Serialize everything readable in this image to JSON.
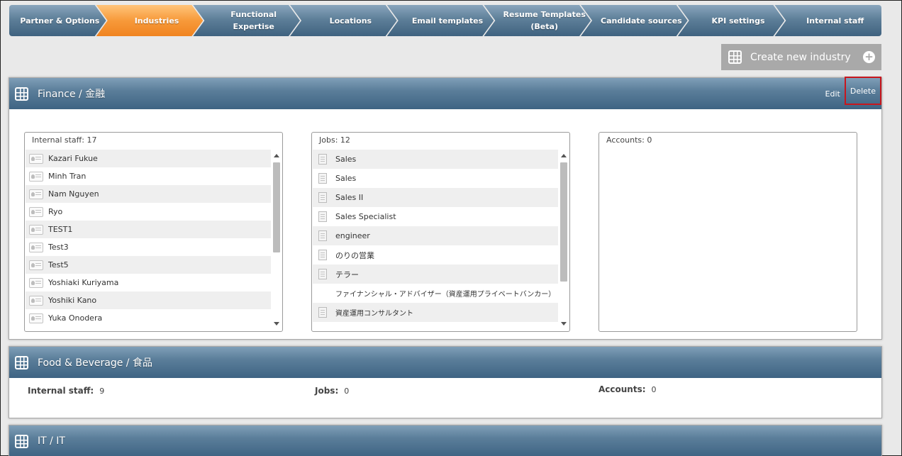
{
  "nav": {
    "steps": [
      {
        "label": "Partner & Options",
        "active": false
      },
      {
        "label": "Industries",
        "active": true
      },
      {
        "label": "Functional\nExpertise",
        "active": false
      },
      {
        "label": "Locations",
        "active": false
      },
      {
        "label": "Email templates",
        "active": false
      },
      {
        "label": "Resume Templates\n(Beta)",
        "active": false
      },
      {
        "label": "Candidate sources",
        "active": false
      },
      {
        "label": "KPI settings",
        "active": false
      },
      {
        "label": "Internal staff",
        "active": false
      }
    ],
    "active_color": "#f79a3a",
    "base_color": "#5e7f99"
  },
  "create_button": {
    "label": "Create new industry",
    "icon": "plus-circle-icon"
  },
  "industries": [
    {
      "title": "Finance / 金融",
      "edit_label": "Edit",
      "delete_label": "Delete",
      "internal_staff": {
        "header": "Internal staff: 17",
        "items": [
          "Kazari Fukue",
          "Minh Tran",
          "Nam Nguyen",
          "Ryo",
          "TEST1",
          "Test3",
          "Test5",
          "Yoshiaki Kuriyama",
          "Yoshiki Kano",
          "Yuka Onodera"
        ]
      },
      "jobs": {
        "header": "Jobs: 12",
        "items": [
          "Sales",
          "Sales",
          "Sales II",
          "Sales Specialist",
          "engineer",
          "のりの営業",
          "テラー",
          "ファイナンシャル・アドバイザー（資産運用プライベートバンカー）",
          "資産運用コンサルタント"
        ]
      },
      "accounts": {
        "header": "Accounts: 0"
      }
    },
    {
      "title": "Food & Beverage / 食品",
      "internal_staff_label": "Internal staff:",
      "internal_staff_value": "9",
      "jobs_label": "Jobs:",
      "jobs_value": "0",
      "accounts_label": "Accounts:",
      "accounts_value": "0"
    },
    {
      "title": "IT / IT"
    }
  ],
  "highlight_color": "#c8161d"
}
